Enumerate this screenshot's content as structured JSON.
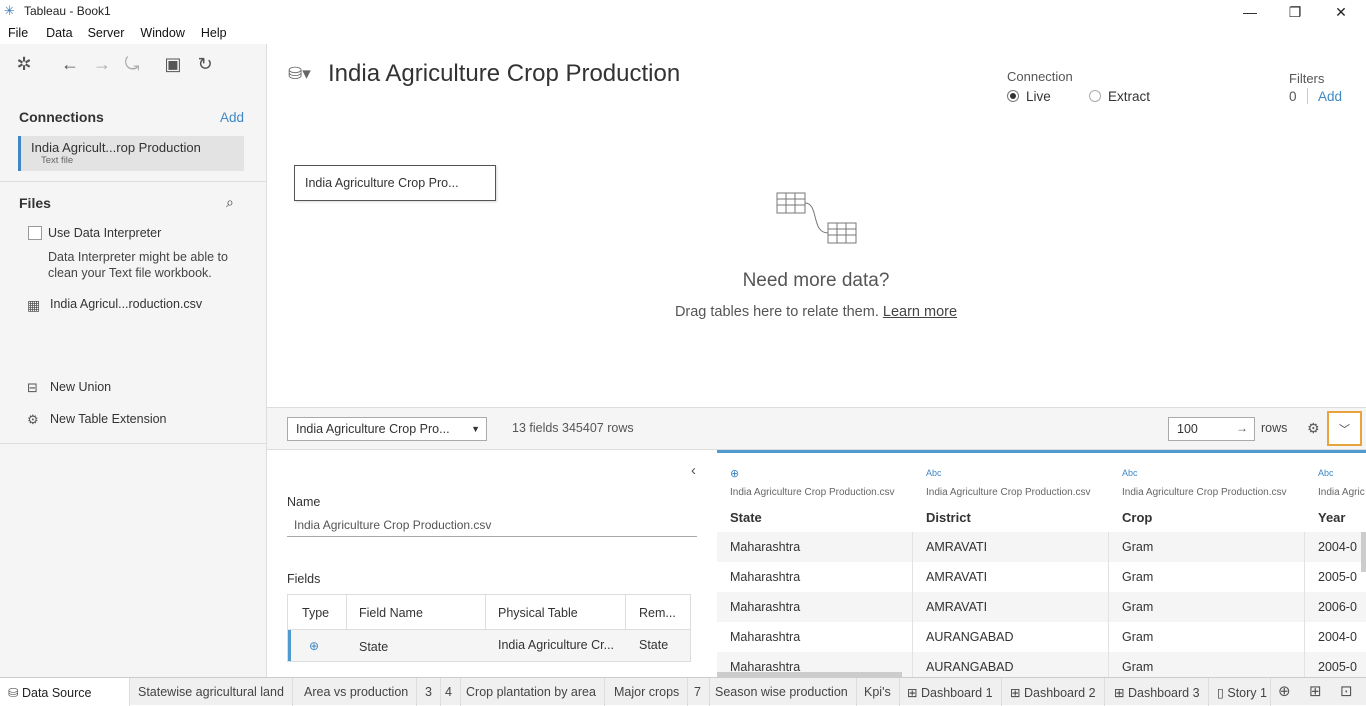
{
  "window": {
    "title": "Tableau - Book1",
    "minimize": "—",
    "restore": "❐",
    "close": "✕"
  },
  "menu": [
    "File",
    "Data",
    "Server",
    "Window",
    "Help"
  ],
  "toolbar": {
    "undo": "←",
    "redo": "→",
    "redo_dropdown": "⤿",
    "save": "▣",
    "refresh": "↻"
  },
  "connections": {
    "heading": "Connections",
    "add_label": "Add",
    "item_name": "India Agricult...rop Production",
    "item_sub": "Text file"
  },
  "files": {
    "heading": "Files",
    "use_interpreter": "Use Data Interpreter",
    "interpreter_note_1": "Data Interpreter might be able to",
    "interpreter_note_2": "clean your Text file workbook.",
    "file_name": "India Agricul...roduction.csv",
    "new_union": "New Union",
    "new_table_ext": "New Table Extension"
  },
  "main": {
    "title": "India Agriculture Crop Production",
    "connection_label": "Connection",
    "live_label": "Live",
    "extract_label": "Extract",
    "filters_label": "Filters",
    "filters_count": "0",
    "filters_add": "Add",
    "table_box": "India Agriculture Crop Pro...",
    "need_more": "Need more data?",
    "drag_text": "Drag tables here to relate them.",
    "learn_more": "Learn more"
  },
  "gridbar": {
    "table_select": "India Agriculture Crop Pro...",
    "summary": "13 fields 345407 rows",
    "rows_value": "100",
    "rows_label": "rows"
  },
  "metadata": {
    "name_label": "Name",
    "name_value": "India Agriculture Crop Production.csv",
    "fields_label": "Fields",
    "headers": [
      "Type",
      "Field Name",
      "Physical Table",
      "Rem..."
    ],
    "row": {
      "field_name": "State",
      "physical_table": "India Agriculture Cr...",
      "remote": "State"
    }
  },
  "grid": {
    "columns": [
      {
        "type_icon": "⊕",
        "source": "India Agriculture Crop Production.csv",
        "name": "State"
      },
      {
        "type_icon": "Abc",
        "source": "India Agriculture Crop Production.csv",
        "name": "District"
      },
      {
        "type_icon": "Abc",
        "source": "India Agriculture Crop Production.csv",
        "name": "Crop"
      },
      {
        "type_icon": "Abc",
        "source": "India Agric",
        "name": "Year"
      }
    ],
    "rows": [
      [
        "Maharashtra",
        "AMRAVATI",
        "Gram",
        "2004-0"
      ],
      [
        "Maharashtra",
        "AMRAVATI",
        "Gram",
        "2005-0"
      ],
      [
        "Maharashtra",
        "AMRAVATI",
        "Gram",
        "2006-0"
      ],
      [
        "Maharashtra",
        "AURANGABAD",
        "Gram",
        "2004-0"
      ],
      [
        "Maharashtra",
        "AURANGABAD",
        "Gram",
        "2005-0"
      ]
    ]
  },
  "tabs": [
    "Data Source",
    "Statewise agricultural land",
    "Area vs production",
    "3",
    "4",
    "Crop plantation by area",
    "Major crops",
    "7",
    "Season wise production",
    "Kpi's",
    "Dashboard 1",
    "Dashboard 2",
    "Dashboard 3",
    "Story 1"
  ],
  "colors": {
    "accent": "#3f87c5",
    "highlight_border": "#e8a33d"
  }
}
